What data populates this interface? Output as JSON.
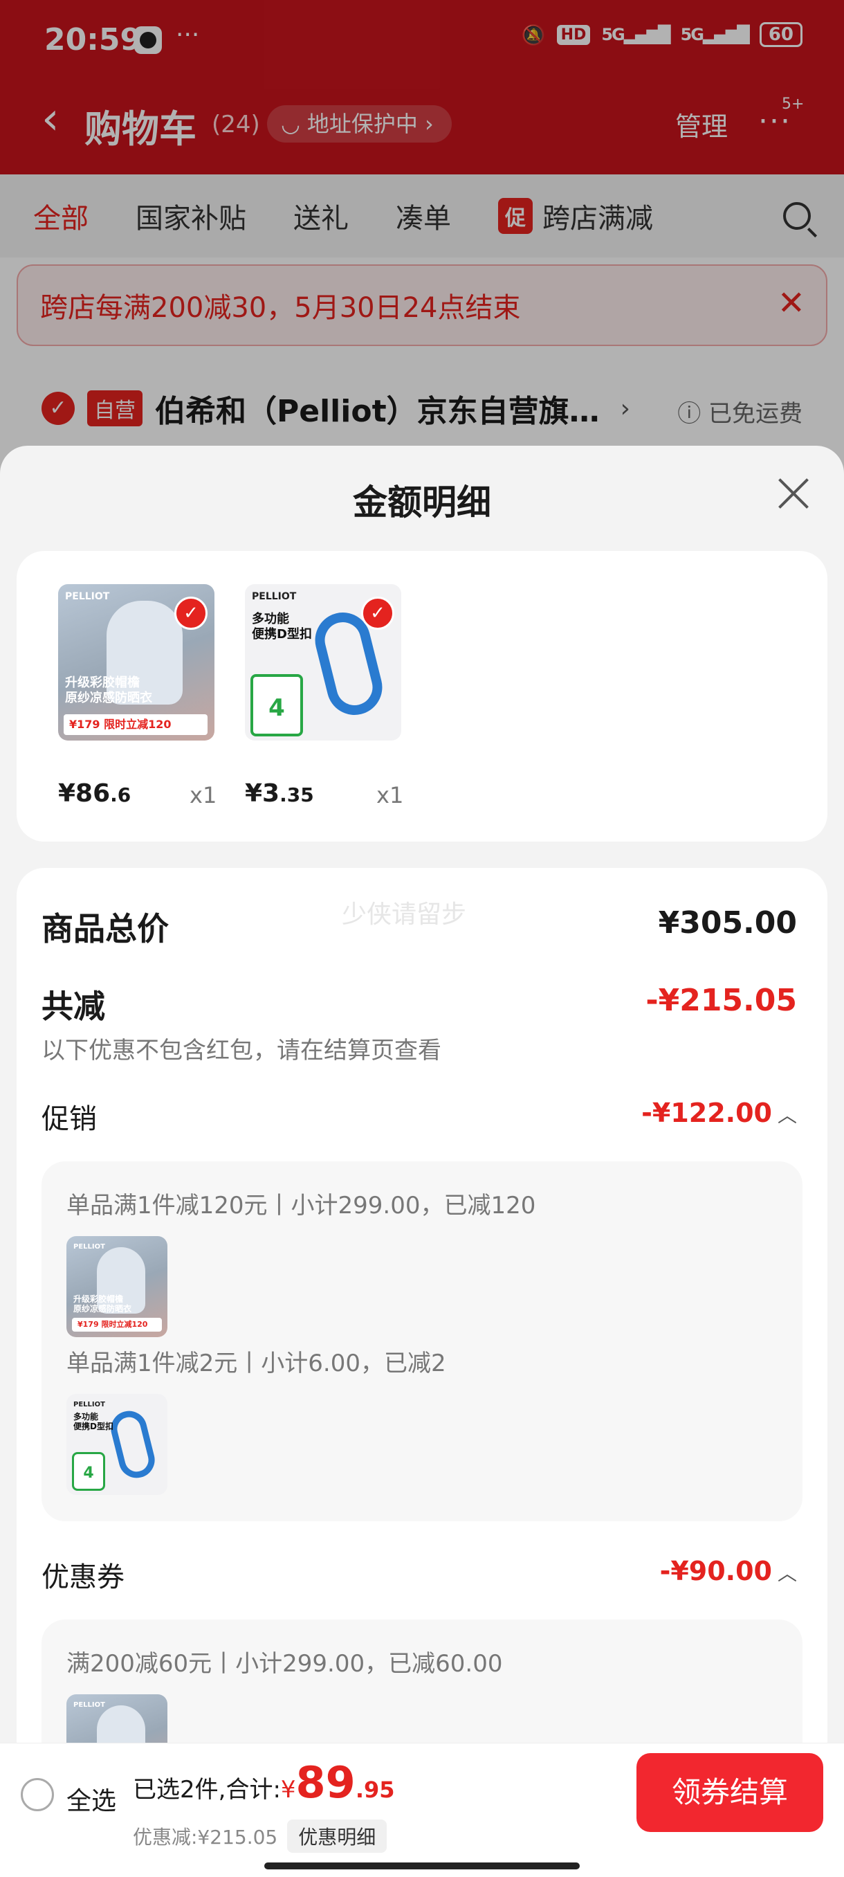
{
  "status_bar": {
    "time": "20:59",
    "dots": "···",
    "hd": "HD",
    "signal1": "5G▂▄▆█",
    "signal2": "5G▂▄▆█",
    "battery": "60"
  },
  "nav": {
    "back_icon": "‹",
    "title": "购物车",
    "count": "(24)",
    "address_protect": "地址保护中",
    "manage": "管理",
    "more_icon": "···",
    "more_badge": "5+"
  },
  "tabs": {
    "all": "全部",
    "subsidy": "国家补贴",
    "gift": "送礼",
    "bundle": "凑单",
    "promo_badge": "促",
    "cross_store": "跨店满减",
    "more": ""
  },
  "banner": {
    "text": "跨店每满200减30，5月30日24点结束",
    "close_icon": "✕"
  },
  "store": {
    "self_badge": "自营",
    "name": "伯希和（Pelliot）京东自营旗…",
    "arrow": "›",
    "shipping": "ⓘ 已免运费"
  },
  "sheet": {
    "title": "金额明细",
    "products": [
      {
        "brand": "PELLIOT",
        "caption": "升级彩胶帽檐\n原纱凉感防晒衣",
        "strip": "¥179 限时立减120",
        "price_main": "¥86",
        "price_dec": ".6",
        "qty": "x1"
      },
      {
        "brand": "PELLIOT",
        "caption": "多功能\n便携D型扣",
        "green": "4",
        "price_main": "¥3",
        "price_dec": ".35",
        "qty": "x1"
      }
    ],
    "watermark": "少侠请留步",
    "total_label": "商品总价",
    "total_value": "¥305.00",
    "reduce_label": "共减",
    "reduce_value": "-¥215.05",
    "reduce_note": "以下优惠不包含红包，请在结算页查看",
    "promo_label": "促销",
    "promo_value": "-¥122.00",
    "promo_lines": [
      "单品满1件减120元丨小计299.00，已减120",
      "单品满1件减2元丨小计6.00，已减2"
    ],
    "coupon_label": "优惠券",
    "coupon_value": "-¥90.00",
    "coupon_lines": [
      "满200减60元丨小计299.00，已减60.00"
    ]
  },
  "bottom": {
    "select_all": "全选",
    "selected_prefix": "已选2件,合计:",
    "yen": "¥",
    "total_int": "89",
    "total_dec": ".95",
    "discount": "优惠减:¥215.05",
    "detail_link": "优惠明细",
    "checkout": "领券结算"
  }
}
